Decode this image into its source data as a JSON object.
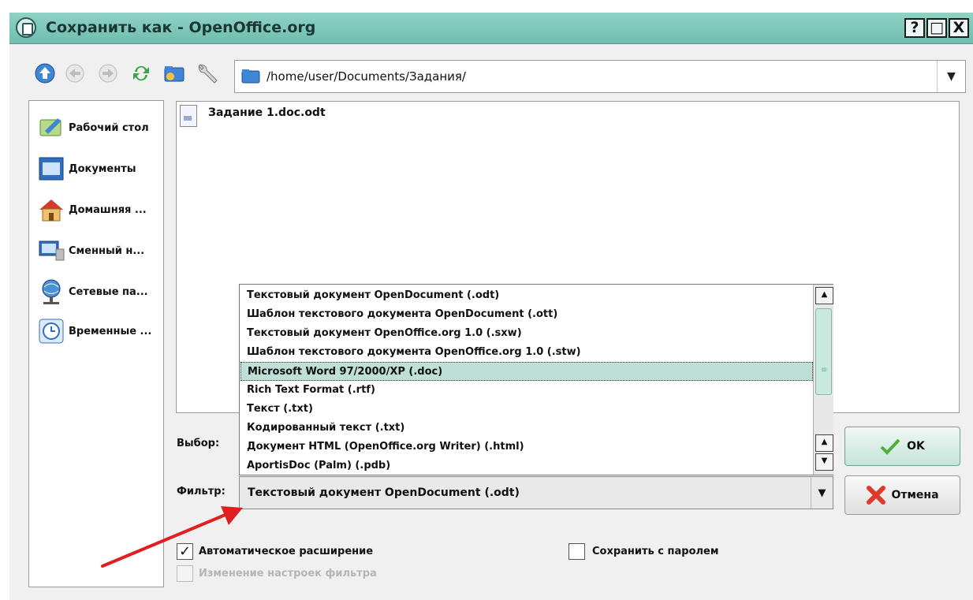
{
  "window": {
    "title": "Сохранить как - OpenOffice.org",
    "help_label": "?",
    "maximize_label": "□",
    "close_label": "X"
  },
  "toolbar": {
    "path": "/home/user/Documents/Задания/",
    "icons": [
      "up-arrow-icon",
      "back-arrow-icon",
      "forward-arrow-icon",
      "refresh-icon",
      "new-folder-icon",
      "tools-icon"
    ]
  },
  "sidebar": {
    "items": [
      {
        "label": "Рабочий стол",
        "icon": "desktop-icon"
      },
      {
        "label": "Документы",
        "icon": "documents-icon"
      },
      {
        "label": "Домашняя ...",
        "icon": "home-icon"
      },
      {
        "label": "Сменный н...",
        "icon": "removable-drive-icon"
      },
      {
        "label": "Сетевые па...",
        "icon": "network-folder-icon"
      },
      {
        "label": "Временные ...",
        "icon": "clock-icon"
      }
    ]
  },
  "files": [
    {
      "name": "Задание 1.doc.odt"
    }
  ],
  "labels": {
    "selection": "Выбор:",
    "filter": "Фильтр:"
  },
  "filter": {
    "value": "Текстовый документ OpenDocument (.odt)",
    "options": [
      "Текстовый документ OpenDocument (.odt)",
      "Шаблон текстового документа OpenDocument (.ott)",
      "Текстовый документ OpenOffice.org 1.0 (.sxw)",
      "Шаблон текстового документа OpenOffice.org 1.0 (.stw)",
      "Microsoft Word 97/2000/XP (.doc)",
      "Rich Text Format (.rtf)",
      "Текст (.txt)",
      "Кодированный текст (.txt)",
      "Документ HTML (OpenOffice.org Writer) (.html)",
      "AportisDoc (Palm) (.pdb)"
    ],
    "highlighted_index": 4
  },
  "buttons": {
    "ok": "OK",
    "cancel": "Отмена"
  },
  "checkboxes": {
    "auto_extension": {
      "label": "Автоматическое расширение",
      "checked": true
    },
    "edit_filter": {
      "label": "Изменение настроек фильтра",
      "checked": false,
      "disabled": true
    },
    "save_password": {
      "label": "Сохранить с паролем",
      "checked": false
    }
  },
  "colors": {
    "titlebar": "#7cc8b8",
    "highlight": "#bfe0d6",
    "annotation_arrow": "#e02020"
  }
}
